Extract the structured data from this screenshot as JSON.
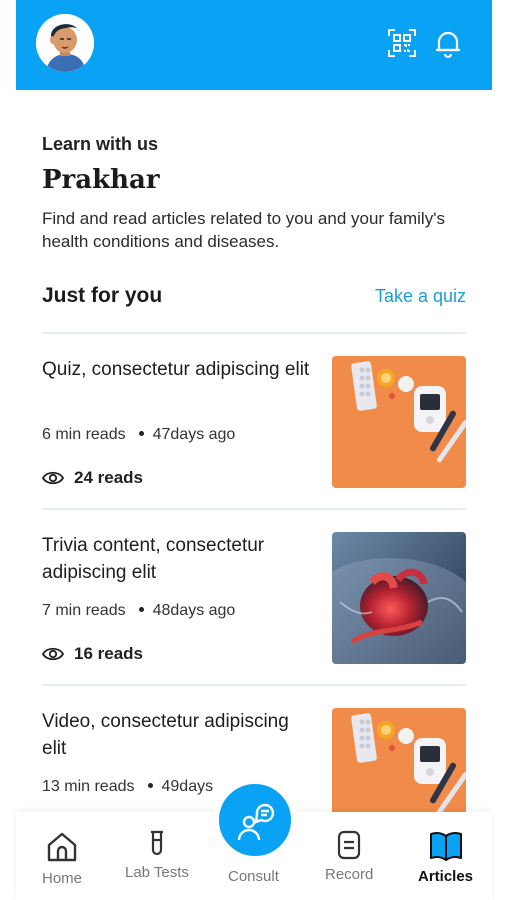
{
  "header": {
    "avatar_icon": "user-avatar-icon",
    "scan_icon": "qr-scan-icon",
    "notification_icon": "bell-icon",
    "brand_color": "#0aa2f5"
  },
  "intro": {
    "learn_label": "Learn with us",
    "user_name": "Prakhar",
    "description": "Find and read articles related to you and your family's health conditions and diseases."
  },
  "section": {
    "title": "Just for you",
    "quiz_link": "Take a quiz",
    "link_color": "#1a9fd6"
  },
  "articles": [
    {
      "title": "Quiz, consectetur adipiscing elit",
      "read_time": "6 min reads",
      "age": "47days ago",
      "reads": "24 reads",
      "thumbnail": "medicine-diabetes-kit-image"
    },
    {
      "title": "Trivia content, consectetur adipiscing elit",
      "read_time": "7 min reads",
      "age": "48days ago",
      "reads": "16 reads",
      "thumbnail": "heart-anatomy-image"
    },
    {
      "title": "Video, consectetur adipiscing elit",
      "read_time": "13 min reads",
      "age": "49days",
      "reads": "",
      "thumbnail": "medicine-diabetes-kit-image"
    }
  ],
  "nav": {
    "home": "Home",
    "lab_tests": "Lab Tests",
    "consult": "Consult",
    "record": "Record",
    "articles": "Articles",
    "active": "Articles"
  }
}
